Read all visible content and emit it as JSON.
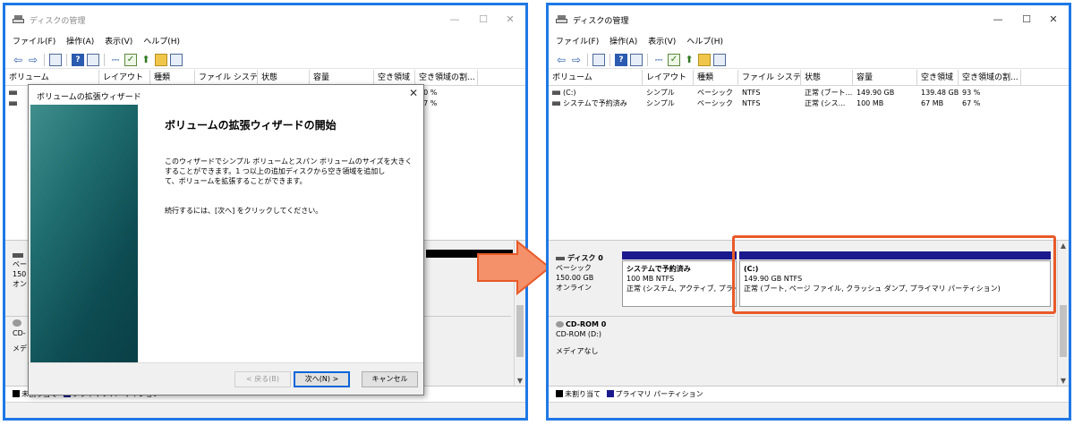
{
  "window": {
    "title": "ディスクの管理",
    "min_glyph": "—",
    "max_glyph": "☐",
    "close_glyph": "✕"
  },
  "menu": [
    "ファイル(F)",
    "操作(A)",
    "表示(V)",
    "ヘルプ(H)"
  ],
  "toolbar": {
    "back_glyph": "⇦",
    "forward_glyph": "⇨",
    "help_glyph": "?",
    "check_glyph": "✓",
    "up_glyph": "⬆"
  },
  "table": {
    "headers": [
      "ボリューム",
      "レイアウト",
      "種類",
      "ファイル システム",
      "状態",
      "容量",
      "空き領域",
      "空き領域の割..."
    ],
    "rows": [
      {
        "volume": "(C:)",
        "layout": "シンプル",
        "type": "ベーシック",
        "fs": "NTFS",
        "status": "正常 (ブート...",
        "capacity": "149.90 GB",
        "free": "139.48 GB",
        "pct": "93 %"
      },
      {
        "volume": "システムで予約済み",
        "layout": "シンプル",
        "type": "ベーシック",
        "fs": "NTFS",
        "status": "正常 (シス...",
        "capacity": "100 MB",
        "free": "67 MB",
        "pct": "67 %"
      }
    ]
  },
  "disks": [
    {
      "name": "ディスク 0",
      "kind": "ベーシック",
      "size": "150.00 GB",
      "state": "オンライン"
    },
    {
      "name": "CD-ROM 0",
      "kind": "CD-ROM (D:)",
      "size": "",
      "state": "メディアなし"
    }
  ],
  "partitions": [
    {
      "name": "システムで予約済み",
      "size": "100 MB NTFS",
      "status": "正常 (システム, アクティブ, プライマ"
    },
    {
      "name": "(C:)",
      "size": "149.90 GB NTFS",
      "status": "正常 (ブート, ページ ファイル, クラッシュ ダンプ, プライマリ パーティション)"
    }
  ],
  "legend": {
    "unallocated": "未割り当て",
    "primary": "プライマリ パーティション"
  },
  "left_partial": {
    "pct_rows": [
      "90 %",
      "67 %"
    ],
    "disk_kind": "ベー",
    "disk_size": "150",
    "disk_state": "オン",
    "cd_kind": "CD-",
    "cd_state": "メデ"
  },
  "wizard": {
    "title": "ボリュームの拡張ウィザード",
    "close_glyph": "✕",
    "heading": "ボリュームの拡張ウィザードの開始",
    "paragraph_lines": [
      "このウィザードでシンプル ボリュームとスパン ボリュームのサイズを大きく",
      "することができます。1 つ以上の追加ディスクから空き領域を追加し",
      "て、ボリュームを拡張することができます。"
    ],
    "continue_text": "続行するには、[次へ] をクリックしてください。",
    "back_button": "< 戻る(B)",
    "next_button": "次へ(N) >",
    "cancel_button": "キャンセル"
  },
  "colors": {
    "frame_border": "#1f78e6",
    "primary_partition": "#1a1a8c",
    "unallocated": "#000000",
    "highlight": "#e85a28",
    "arrow_fill": "#f4916a",
    "wizard_side": "#1f6c6e"
  }
}
